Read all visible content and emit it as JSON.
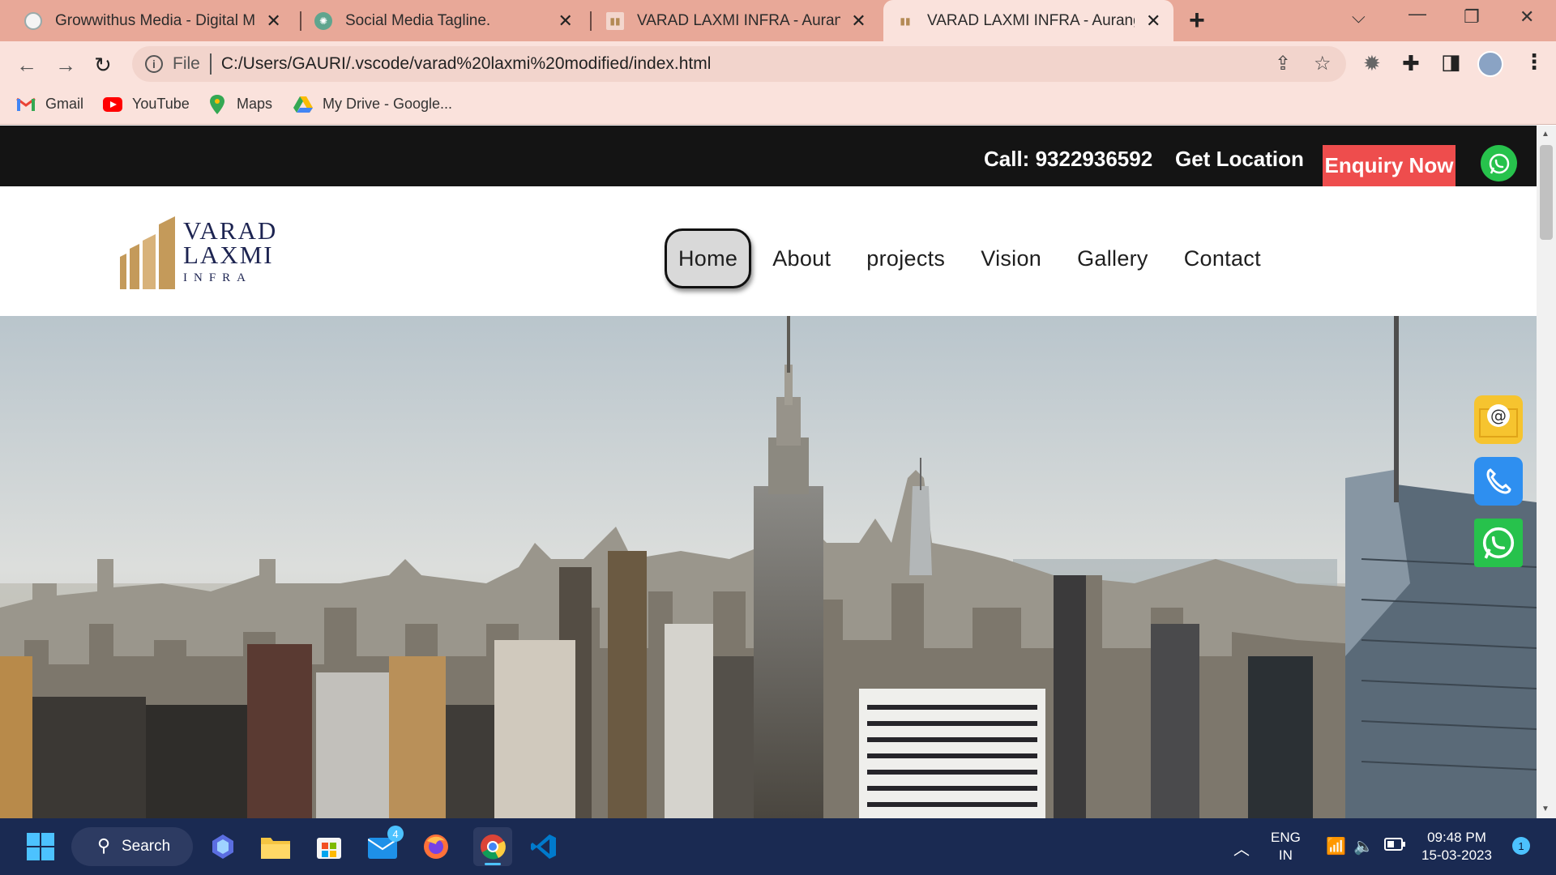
{
  "browser": {
    "tabs": [
      {
        "label": "Growwithus Media - Digital Marketing",
        "active": false
      },
      {
        "label": "Social Media Tagline.",
        "active": false
      },
      {
        "label": "VARAD LAXMI INFRA - Aurangabad",
        "active": false
      },
      {
        "label": "VARAD LAXMI INFRA - Aurangabad",
        "active": true
      }
    ],
    "address_scheme": "File",
    "address": "C:/Users/GAURI/.vscode/varad%20laxmi%20modified/index.html",
    "bookmarks": [
      "Gmail",
      "YouTube",
      "Maps",
      "My Drive - Google..."
    ]
  },
  "site": {
    "topbar": {
      "call": "Call: 9322936592",
      "location": "Get Location",
      "enquiry": "Enquiry Now"
    },
    "logo": {
      "line1": "VARAD",
      "line2": "LAXMI",
      "line3": "INFRA"
    },
    "menu": [
      "Home",
      "About",
      "projects",
      "Vision",
      "Gallery",
      "Contact"
    ]
  },
  "taskbar": {
    "search_label": "Search",
    "mail_badge": "4",
    "lang_line1": "ENG",
    "lang_line2": "IN",
    "time": "09:48 PM",
    "date": "15-03-2023",
    "notification_count": "1"
  },
  "colors": {
    "tabstrip": "#e8a898",
    "toolbar": "#fae2dc",
    "topbar": "#141414",
    "enquiry": "#ee4d4d",
    "whatsapp": "#27c24c",
    "logo_gold": "#c49a5a",
    "logo_navy": "#1d2451",
    "taskbar": "#1a2a52"
  }
}
